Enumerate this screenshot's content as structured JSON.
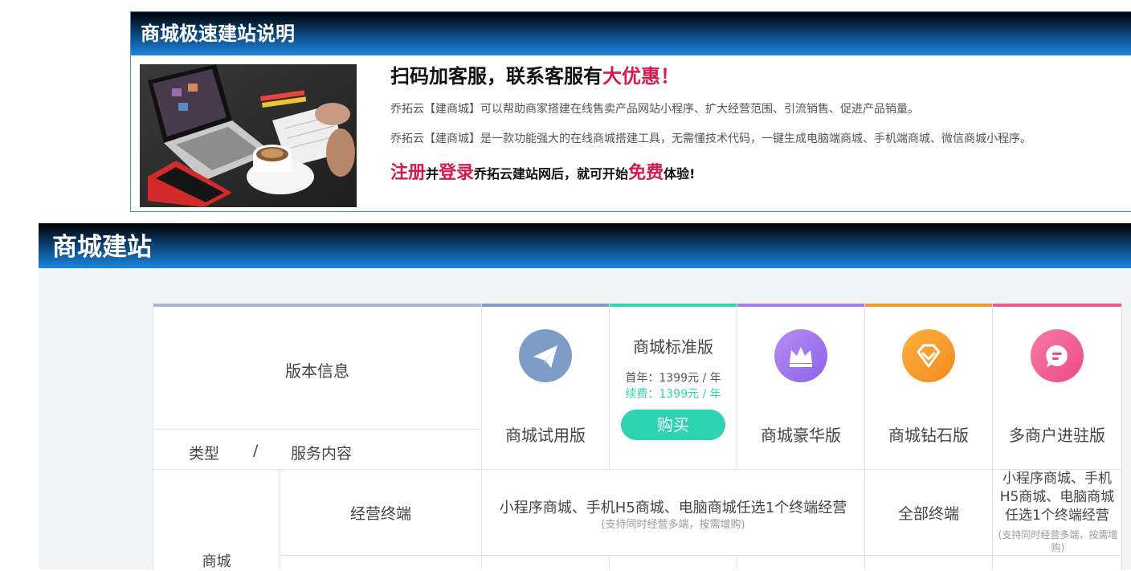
{
  "intro": {
    "title": "商城极速建站说明",
    "headline_pre": "扫码加客服，联系客服有",
    "headline_highlight": "大优惠！",
    "para1": "乔拓云【建商城】可以帮助商家搭建在线售卖产品网站小程序、扩大经营范围、引流销售、促进产品销量。",
    "para2": "乔拓云【建商城】是一款功能强大的在线商城搭建工具，无需懂技术代码，一键生成电脑端商城、手机端商城、微信商城小程序。",
    "cta": {
      "register": "注册",
      "and": "并",
      "login": "登录",
      "mid": "乔拓云建站网后，就可开始",
      "free": "免费",
      "end": "体验!"
    }
  },
  "section": {
    "title": "商城建站"
  },
  "table": {
    "version_info": "版本信息",
    "type_label": "类型",
    "slash": "/",
    "service_label": "服务内容",
    "category_mall": "商城",
    "row_terminal_label": "经营终端",
    "plans": [
      {
        "name": "商城试用版",
        "color": "#7e9cc8",
        "icon": "paper-plane-icon"
      },
      {
        "name": "商城标准版",
        "color": "#2ed3b0",
        "first_year": "首年：1399元 / 年",
        "renewal": "续费：1399元 / 年",
        "buy": "购买"
      },
      {
        "name": "商城豪华版",
        "color": "#a47ef0",
        "icon": "crown-icon"
      },
      {
        "name": "商城钻石版",
        "color": "#f7962f",
        "icon": "diamond-icon"
      },
      {
        "name": "多商户进驻版",
        "color": "#f0568f",
        "icon": "chat-bubble-icon"
      }
    ],
    "terminal_merged": "小程序商城、手机H5商城、电脑商城任选1个终端经营",
    "terminal_merged_note": "(支持同时经营多端，按需增购)",
    "terminal_diamond": "全部终端",
    "terminal_multi": "小程序商城、手机H5商城、电脑商城任选1个终端经营",
    "terminal_multi_note": "(支持同时经营多端，按需增购)"
  },
  "colors": {
    "header_gradient_end": "#1b86e0",
    "accent_red": "#d9184e",
    "teal": "#2ed3b0"
  }
}
